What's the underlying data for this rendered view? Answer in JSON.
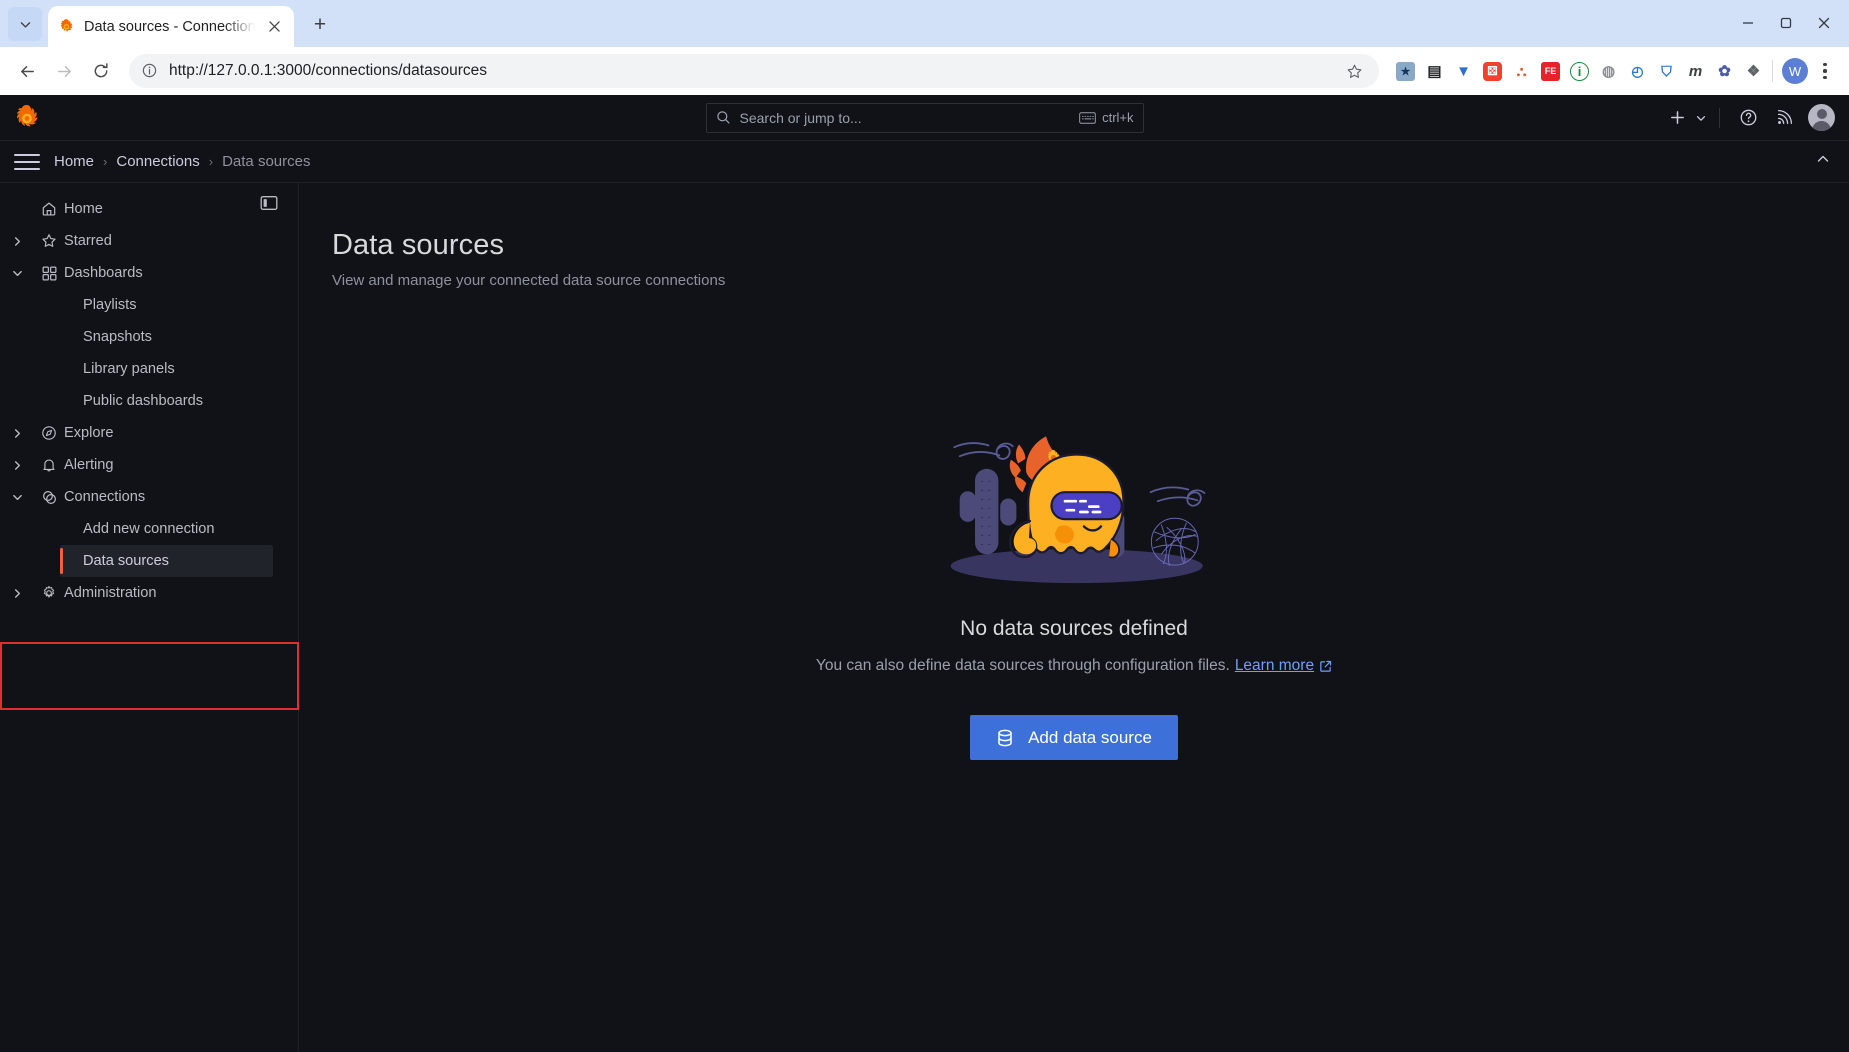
{
  "browser": {
    "tab": {
      "title": "Data sources - Connections - Grafana",
      "favicon": "grafana-logo-icon",
      "close_icon": "close-icon"
    },
    "new_tab_label": "+",
    "tab_list_chevron": "chevron-down-icon",
    "window_controls": {
      "minimize": "minimize-icon",
      "maximize": "maximize-icon",
      "close": "close-icon"
    },
    "nav": {
      "back": "back-arrow-icon",
      "forward": "forward-arrow-icon",
      "reload": "reload-icon"
    },
    "omnibox": {
      "url": "http://127.0.0.1:3000/connections/datasources",
      "info_icon": "info-circle-icon",
      "star_icon": "bookmark-star-icon"
    },
    "extensions": [
      {
        "name": "bookmark-manager-extension-icon",
        "glyph": "★",
        "bg": "#8aa9c9",
        "fg": "#14365c"
      },
      {
        "name": "qr-code-extension-icon",
        "glyph": "▒",
        "bg": "#ffffff",
        "fg": "#202124"
      },
      {
        "name": "funnel-filter-extension-icon",
        "glyph": "▼",
        "bg": "#ffffff",
        "fg": "#2f6fd0"
      },
      {
        "name": "dice-extension-icon",
        "glyph": "⚅",
        "bg": "#f2402f",
        "fg": "#ffffff"
      },
      {
        "name": "sitemap-extension-icon",
        "glyph": "⑂",
        "bg": "#ffffff",
        "fg": "#e06030"
      },
      {
        "name": "fe-extension-icon",
        "glyph": "FE",
        "bg": "#e8222a",
        "fg": "#ffffff"
      },
      {
        "name": "shield-info-extension-icon",
        "glyph": "i",
        "bg": "#ffffff",
        "fg": "#1a8a3c"
      },
      {
        "name": "globe-extension-icon",
        "glyph": "◌",
        "bg": "#ffffff",
        "fg": "#8e9096"
      },
      {
        "name": "clock-extension-icon",
        "glyph": "◔",
        "bg": "#ffffff",
        "fg": "#2a7ad4"
      },
      {
        "name": "shield-extension-icon",
        "glyph": "⛊",
        "bg": "#ffffff",
        "fg": "#2f6fd0"
      },
      {
        "name": "m-extension-icon",
        "glyph": "m",
        "bg": "#ffffff",
        "fg": "#3c4043"
      },
      {
        "name": "flower-extension-icon",
        "glyph": "✿",
        "bg": "#ffffff",
        "fg": "#4a5aa8"
      },
      {
        "name": "puzzle-extensions-icon",
        "glyph": "❖",
        "bg": "#ffffff",
        "fg": "#5f6368"
      }
    ],
    "profile_initial": "W",
    "menu_icon": "three-dot-menu-icon"
  },
  "grafana": {
    "logo": "grafana-logo",
    "search": {
      "placeholder": "Search or jump to...",
      "shortcut": "ctrl+k",
      "icon": "search-icon",
      "kbd_icon": "keyboard-icon"
    },
    "topbar_actions": {
      "new_label": "+",
      "new_chevron": "chevron-down-icon",
      "help": "help-circle-icon",
      "news": "news-rss-icon",
      "avatar": "user-avatar"
    },
    "breadcrumb": {
      "menu_icon": "hamburger-menu-icon",
      "items": [
        "Home",
        "Connections",
        "Data sources"
      ],
      "separator": "›",
      "collapse_icon": "chevron-up-icon"
    },
    "sidebar": {
      "panel_toggle_icon": "dock-menu-icon",
      "items": [
        {
          "label": "Home",
          "icon": "home-icon",
          "caret": "none",
          "level": 0,
          "active": false
        },
        {
          "label": "Starred",
          "icon": "star-icon",
          "caret": "right",
          "level": 0,
          "active": false
        },
        {
          "label": "Dashboards",
          "icon": "apps-grid-icon",
          "caret": "down",
          "level": 0,
          "active": false
        },
        {
          "label": "Playlists",
          "icon": "none",
          "caret": "none",
          "level": 1,
          "active": false
        },
        {
          "label": "Snapshots",
          "icon": "none",
          "caret": "none",
          "level": 1,
          "active": false
        },
        {
          "label": "Library panels",
          "icon": "none",
          "caret": "none",
          "level": 1,
          "active": false
        },
        {
          "label": "Public dashboards",
          "icon": "none",
          "caret": "none",
          "level": 1,
          "active": false
        },
        {
          "label": "Explore",
          "icon": "compass-icon",
          "caret": "right",
          "level": 0,
          "active": false
        },
        {
          "label": "Alerting",
          "icon": "bell-icon",
          "caret": "right",
          "level": 0,
          "active": false
        },
        {
          "label": "Connections",
          "icon": "connections-icon",
          "caret": "down",
          "level": 0,
          "active": false
        },
        {
          "label": "Add new connection",
          "icon": "none",
          "caret": "none",
          "level": 1,
          "active": false
        },
        {
          "label": "Data sources",
          "icon": "none",
          "caret": "none",
          "level": 1,
          "active": true
        },
        {
          "label": "Administration",
          "icon": "gear-icon",
          "caret": "right",
          "level": 0,
          "active": false
        }
      ]
    },
    "page": {
      "title": "Data sources",
      "subtitle": "View and manage your connected data source connections"
    },
    "empty_state": {
      "illustration": "grafana-mascot-desert-illustration",
      "title": "No data sources defined",
      "description": "You can also define data sources through configuration files.",
      "link_text": "Learn more",
      "link_icon": "external-link-icon",
      "button_label": "Add data source",
      "button_icon": "database-icon"
    },
    "annotation": {
      "highlight_color": "#e02f2f",
      "active_accent_color": "#f55f3e"
    }
  }
}
